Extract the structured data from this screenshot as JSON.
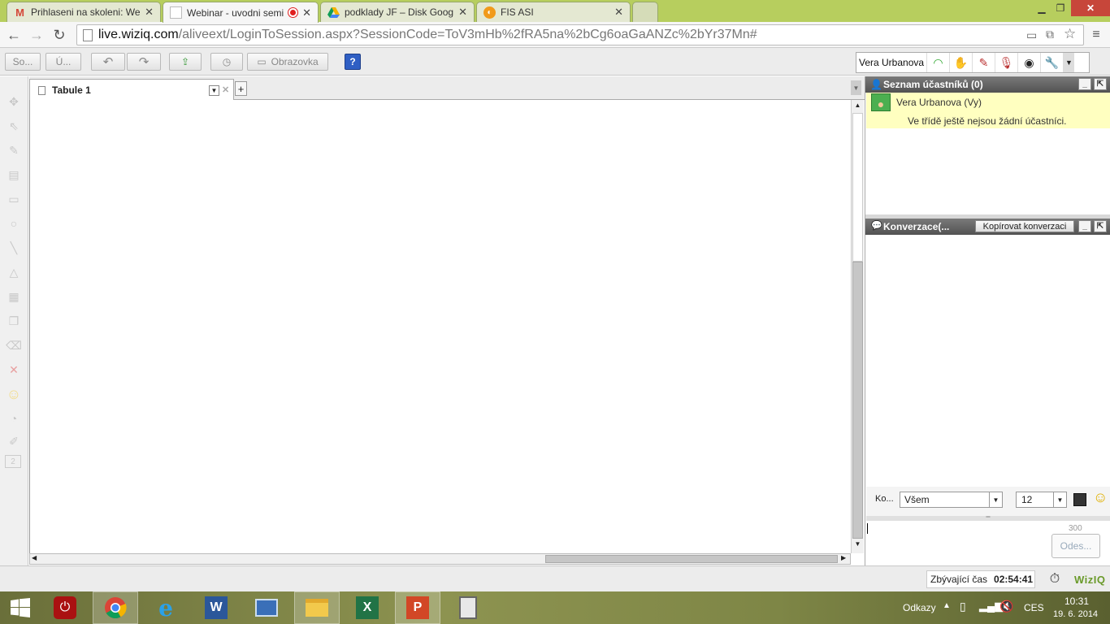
{
  "browser": {
    "tabs": [
      {
        "title": "Prihlaseni na skoleni: Web",
        "icon": "gmail-icon",
        "active": false
      },
      {
        "title": "Webinar - uvodni semi",
        "icon": "page-icon",
        "active": true,
        "recording": true
      },
      {
        "title": "podklady JF – Disk Google",
        "icon": "google-drive-icon",
        "active": false
      },
      {
        "title": "FIS ASI",
        "icon": "fis-icon",
        "active": false
      }
    ],
    "url_host": "live.wiziq.com",
    "url_path": "/aliveext/LoginToSession.aspx?SessionCode=ToV3mHb%2fRA5na%2bCg6oaGaANZc%2bYr37Mn#"
  },
  "toolbar": {
    "btn1": "So...",
    "btn2": "Ú...",
    "screen_label": "Obrazovka",
    "help": "?",
    "user_name": "Vera Urbanova"
  },
  "whiteboard": {
    "tab_label": "Tabule 1",
    "add_tab": "+",
    "page_number": "2"
  },
  "participants": {
    "header": "Seznam účastníků (0)",
    "me": "Vera Urbanova (Vy)",
    "empty_msg": "Ve třídě ještě nejsou žádní účastníci."
  },
  "chat": {
    "header": "Konverzace(...",
    "copy_btn": "Kopírovat konverzaci",
    "to_label": "Ko...",
    "to_value": "Všem",
    "font_size": "12",
    "char_count": "300",
    "send_btn": "Odes..."
  },
  "status": {
    "remaining_label": "Zbývající čas",
    "remaining_value": "02:54:41",
    "brand": "WizIQ"
  },
  "taskbar": {
    "links_label": "Odkazy",
    "lang": "CES",
    "time": "10:31",
    "date": "19. 6. 2014"
  },
  "colors": {
    "tab_strip": "#b7ce5e",
    "panel_header": "#5e5e5e",
    "participant_highlight": "#ffffc0",
    "help_blue": "#2f5fc4"
  }
}
